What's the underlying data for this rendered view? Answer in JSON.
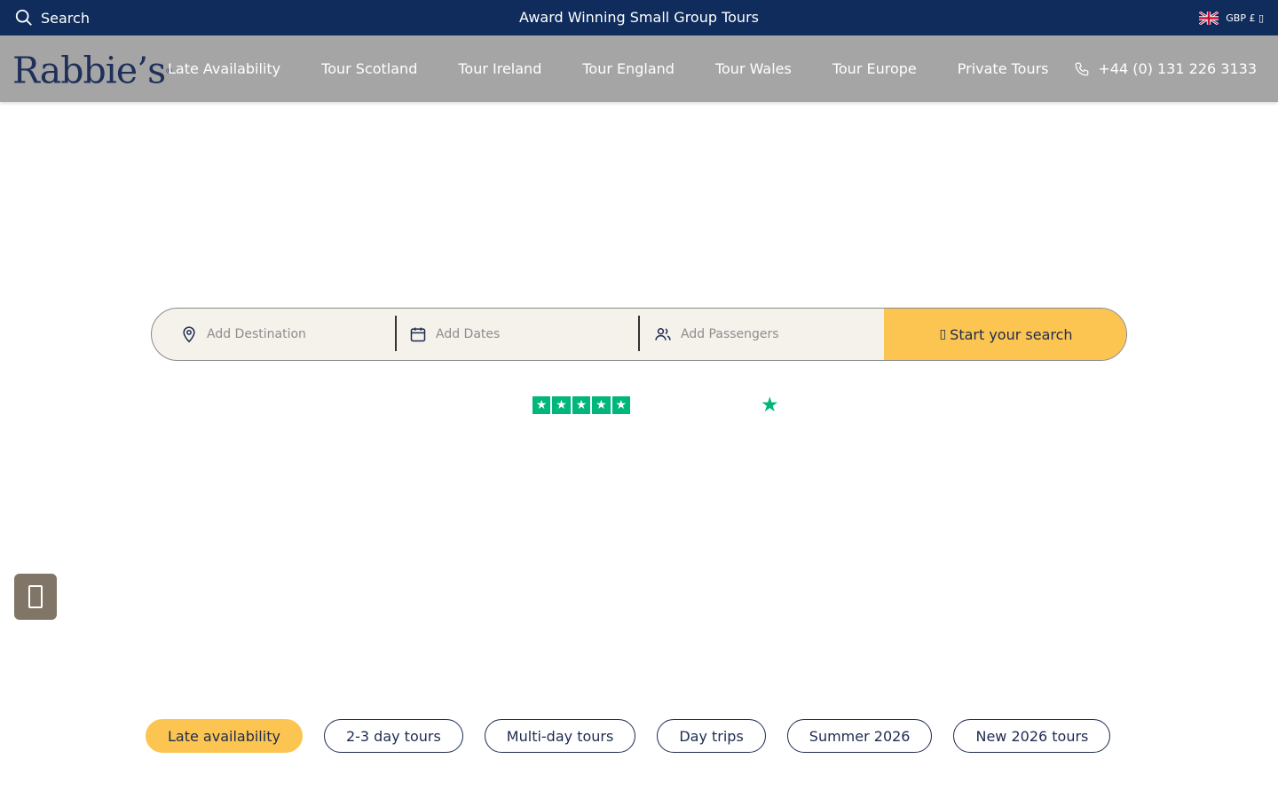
{
  "topbar": {
    "search_label": "Search",
    "tagline": "Award Winning Small Group Tours",
    "currency_label": "GBP £ ▯",
    "flag_icon": "uk-flag-icon"
  },
  "navbar": {
    "logo_text": "Rabbie’s",
    "logo_mark": "®",
    "items": [
      {
        "label": "Late Availability"
      },
      {
        "label": "Tour Scotland"
      },
      {
        "label": "Tour Ireland"
      },
      {
        "label": "Tour England"
      },
      {
        "label": "Tour Wales"
      },
      {
        "label": "Tour Europe"
      },
      {
        "label": "Private Tours"
      }
    ],
    "phone": "+44 (0) 131 226 3133"
  },
  "search_widget": {
    "destination_placeholder": "Add Destination",
    "dates_placeholder": "Add Dates",
    "passengers_placeholder": "Add Passengers",
    "button_label": "Start your search",
    "button_glyph": "▯"
  },
  "trustpilot": {
    "stars_filled": 5,
    "stars_total": 5,
    "accent_color": "#00b67a"
  },
  "pills": [
    {
      "label": "Late availability",
      "active": true
    },
    {
      "label": "2-3 day tours",
      "active": false
    },
    {
      "label": "Multi-day tours",
      "active": false
    },
    {
      "label": "Day trips",
      "active": false
    },
    {
      "label": "Summer 2026",
      "active": false
    },
    {
      "label": "New 2026 tours",
      "active": false
    }
  ],
  "colors": {
    "topbar_bg": "#0f2c5c",
    "navbar_bg": "#a5a5a5",
    "brand_navy": "#1e2f5a",
    "accent_yellow": "#fcc451",
    "side_tab_bg": "#807566"
  }
}
